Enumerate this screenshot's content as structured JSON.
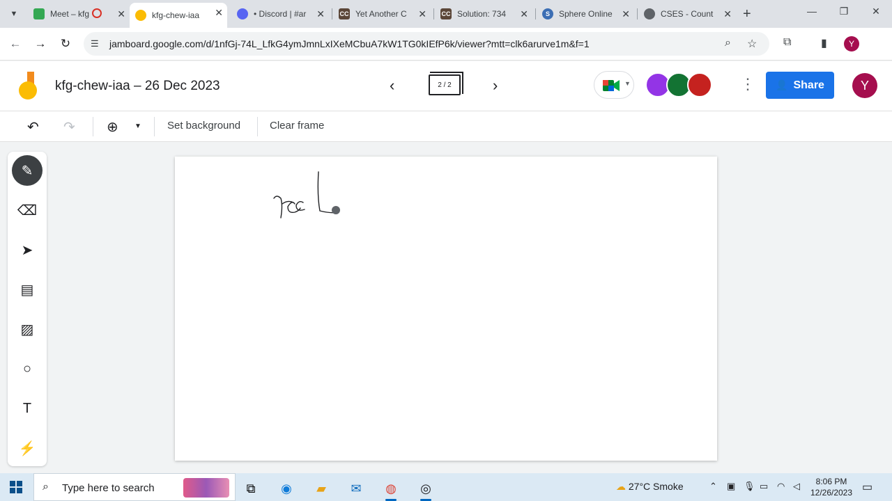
{
  "browser": {
    "tabs": [
      {
        "title": "Meet – kfg",
        "icon": "meet-icon",
        "color": "#34a853"
      },
      {
        "title": "kfg-chew-iaa",
        "icon": "jamboard-icon",
        "color": "#fbbc04",
        "active": true
      },
      {
        "title": "• Discord | #ar",
        "icon": "discord-icon",
        "color": "#5865f2"
      },
      {
        "title": "Yet Another C",
        "icon": "codechef-icon",
        "color": "#5b4638"
      },
      {
        "title": "Solution: 734",
        "icon": "codechef-icon",
        "color": "#5b4638"
      },
      {
        "title": "Sphere Online",
        "icon": "spoj-icon",
        "color": "#3c6eb4"
      },
      {
        "title": "CSES - Count",
        "icon": "globe-icon",
        "color": "#5f6368"
      }
    ],
    "url": "jamboard.google.com/d/1nfGj-74L_LfkG4ymJmnLxIXeMCbuA7kW1TG0kIEfP6k/viewer?mtt=clk6arurve1m&f=1",
    "profile_initial": "Y"
  },
  "jamboard": {
    "title": "kfg-chew-iaa – 26 Dec 2023",
    "frame_counter": "2 / 2",
    "share_label": "Share",
    "user_initial": "Y",
    "toolbar": {
      "set_background": "Set background",
      "clear_frame": "Clear frame"
    },
    "tools": [
      "pen",
      "eraser",
      "select",
      "sticky-note",
      "image",
      "circle",
      "text-box",
      "laser"
    ],
    "active_tool": "pen",
    "collaborators": [
      {
        "icon": "bird-icon",
        "color": "#9334e6"
      },
      {
        "icon": "cat-icon",
        "color": "#137333"
      },
      {
        "icon": "fox-icon",
        "color": "#c5221f"
      }
    ],
    "canvas_ink": "rect"
  },
  "taskbar": {
    "search_placeholder": "Type here to search",
    "weather": "27°C  Smoke",
    "time": "8:06 PM",
    "date": "12/26/2023"
  }
}
